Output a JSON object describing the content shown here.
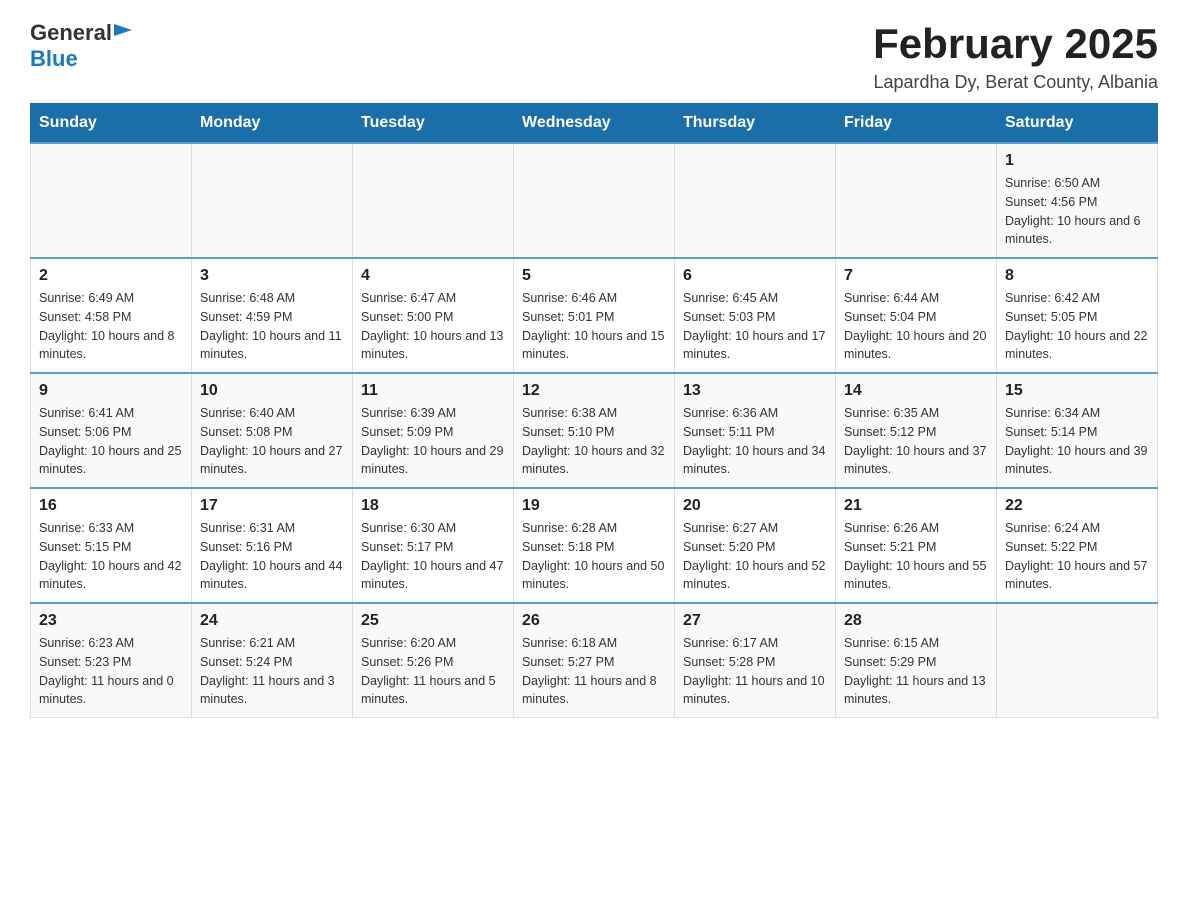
{
  "header": {
    "logo_general": "General",
    "logo_blue": "Blue",
    "title": "February 2025",
    "location": "Lapardha Dy, Berat County, Albania"
  },
  "weekdays": [
    "Sunday",
    "Monday",
    "Tuesday",
    "Wednesday",
    "Thursday",
    "Friday",
    "Saturday"
  ],
  "weeks": [
    [
      {
        "day": "",
        "info": ""
      },
      {
        "day": "",
        "info": ""
      },
      {
        "day": "",
        "info": ""
      },
      {
        "day": "",
        "info": ""
      },
      {
        "day": "",
        "info": ""
      },
      {
        "day": "",
        "info": ""
      },
      {
        "day": "1",
        "info": "Sunrise: 6:50 AM\nSunset: 4:56 PM\nDaylight: 10 hours and 6 minutes."
      }
    ],
    [
      {
        "day": "2",
        "info": "Sunrise: 6:49 AM\nSunset: 4:58 PM\nDaylight: 10 hours and 8 minutes."
      },
      {
        "day": "3",
        "info": "Sunrise: 6:48 AM\nSunset: 4:59 PM\nDaylight: 10 hours and 11 minutes."
      },
      {
        "day": "4",
        "info": "Sunrise: 6:47 AM\nSunset: 5:00 PM\nDaylight: 10 hours and 13 minutes."
      },
      {
        "day": "5",
        "info": "Sunrise: 6:46 AM\nSunset: 5:01 PM\nDaylight: 10 hours and 15 minutes."
      },
      {
        "day": "6",
        "info": "Sunrise: 6:45 AM\nSunset: 5:03 PM\nDaylight: 10 hours and 17 minutes."
      },
      {
        "day": "7",
        "info": "Sunrise: 6:44 AM\nSunset: 5:04 PM\nDaylight: 10 hours and 20 minutes."
      },
      {
        "day": "8",
        "info": "Sunrise: 6:42 AM\nSunset: 5:05 PM\nDaylight: 10 hours and 22 minutes."
      }
    ],
    [
      {
        "day": "9",
        "info": "Sunrise: 6:41 AM\nSunset: 5:06 PM\nDaylight: 10 hours and 25 minutes."
      },
      {
        "day": "10",
        "info": "Sunrise: 6:40 AM\nSunset: 5:08 PM\nDaylight: 10 hours and 27 minutes."
      },
      {
        "day": "11",
        "info": "Sunrise: 6:39 AM\nSunset: 5:09 PM\nDaylight: 10 hours and 29 minutes."
      },
      {
        "day": "12",
        "info": "Sunrise: 6:38 AM\nSunset: 5:10 PM\nDaylight: 10 hours and 32 minutes."
      },
      {
        "day": "13",
        "info": "Sunrise: 6:36 AM\nSunset: 5:11 PM\nDaylight: 10 hours and 34 minutes."
      },
      {
        "day": "14",
        "info": "Sunrise: 6:35 AM\nSunset: 5:12 PM\nDaylight: 10 hours and 37 minutes."
      },
      {
        "day": "15",
        "info": "Sunrise: 6:34 AM\nSunset: 5:14 PM\nDaylight: 10 hours and 39 minutes."
      }
    ],
    [
      {
        "day": "16",
        "info": "Sunrise: 6:33 AM\nSunset: 5:15 PM\nDaylight: 10 hours and 42 minutes."
      },
      {
        "day": "17",
        "info": "Sunrise: 6:31 AM\nSunset: 5:16 PM\nDaylight: 10 hours and 44 minutes."
      },
      {
        "day": "18",
        "info": "Sunrise: 6:30 AM\nSunset: 5:17 PM\nDaylight: 10 hours and 47 minutes."
      },
      {
        "day": "19",
        "info": "Sunrise: 6:28 AM\nSunset: 5:18 PM\nDaylight: 10 hours and 50 minutes."
      },
      {
        "day": "20",
        "info": "Sunrise: 6:27 AM\nSunset: 5:20 PM\nDaylight: 10 hours and 52 minutes."
      },
      {
        "day": "21",
        "info": "Sunrise: 6:26 AM\nSunset: 5:21 PM\nDaylight: 10 hours and 55 minutes."
      },
      {
        "day": "22",
        "info": "Sunrise: 6:24 AM\nSunset: 5:22 PM\nDaylight: 10 hours and 57 minutes."
      }
    ],
    [
      {
        "day": "23",
        "info": "Sunrise: 6:23 AM\nSunset: 5:23 PM\nDaylight: 11 hours and 0 minutes."
      },
      {
        "day": "24",
        "info": "Sunrise: 6:21 AM\nSunset: 5:24 PM\nDaylight: 11 hours and 3 minutes."
      },
      {
        "day": "25",
        "info": "Sunrise: 6:20 AM\nSunset: 5:26 PM\nDaylight: 11 hours and 5 minutes."
      },
      {
        "day": "26",
        "info": "Sunrise: 6:18 AM\nSunset: 5:27 PM\nDaylight: 11 hours and 8 minutes."
      },
      {
        "day": "27",
        "info": "Sunrise: 6:17 AM\nSunset: 5:28 PM\nDaylight: 11 hours and 10 minutes."
      },
      {
        "day": "28",
        "info": "Sunrise: 6:15 AM\nSunset: 5:29 PM\nDaylight: 11 hours and 13 minutes."
      },
      {
        "day": "",
        "info": ""
      }
    ]
  ]
}
